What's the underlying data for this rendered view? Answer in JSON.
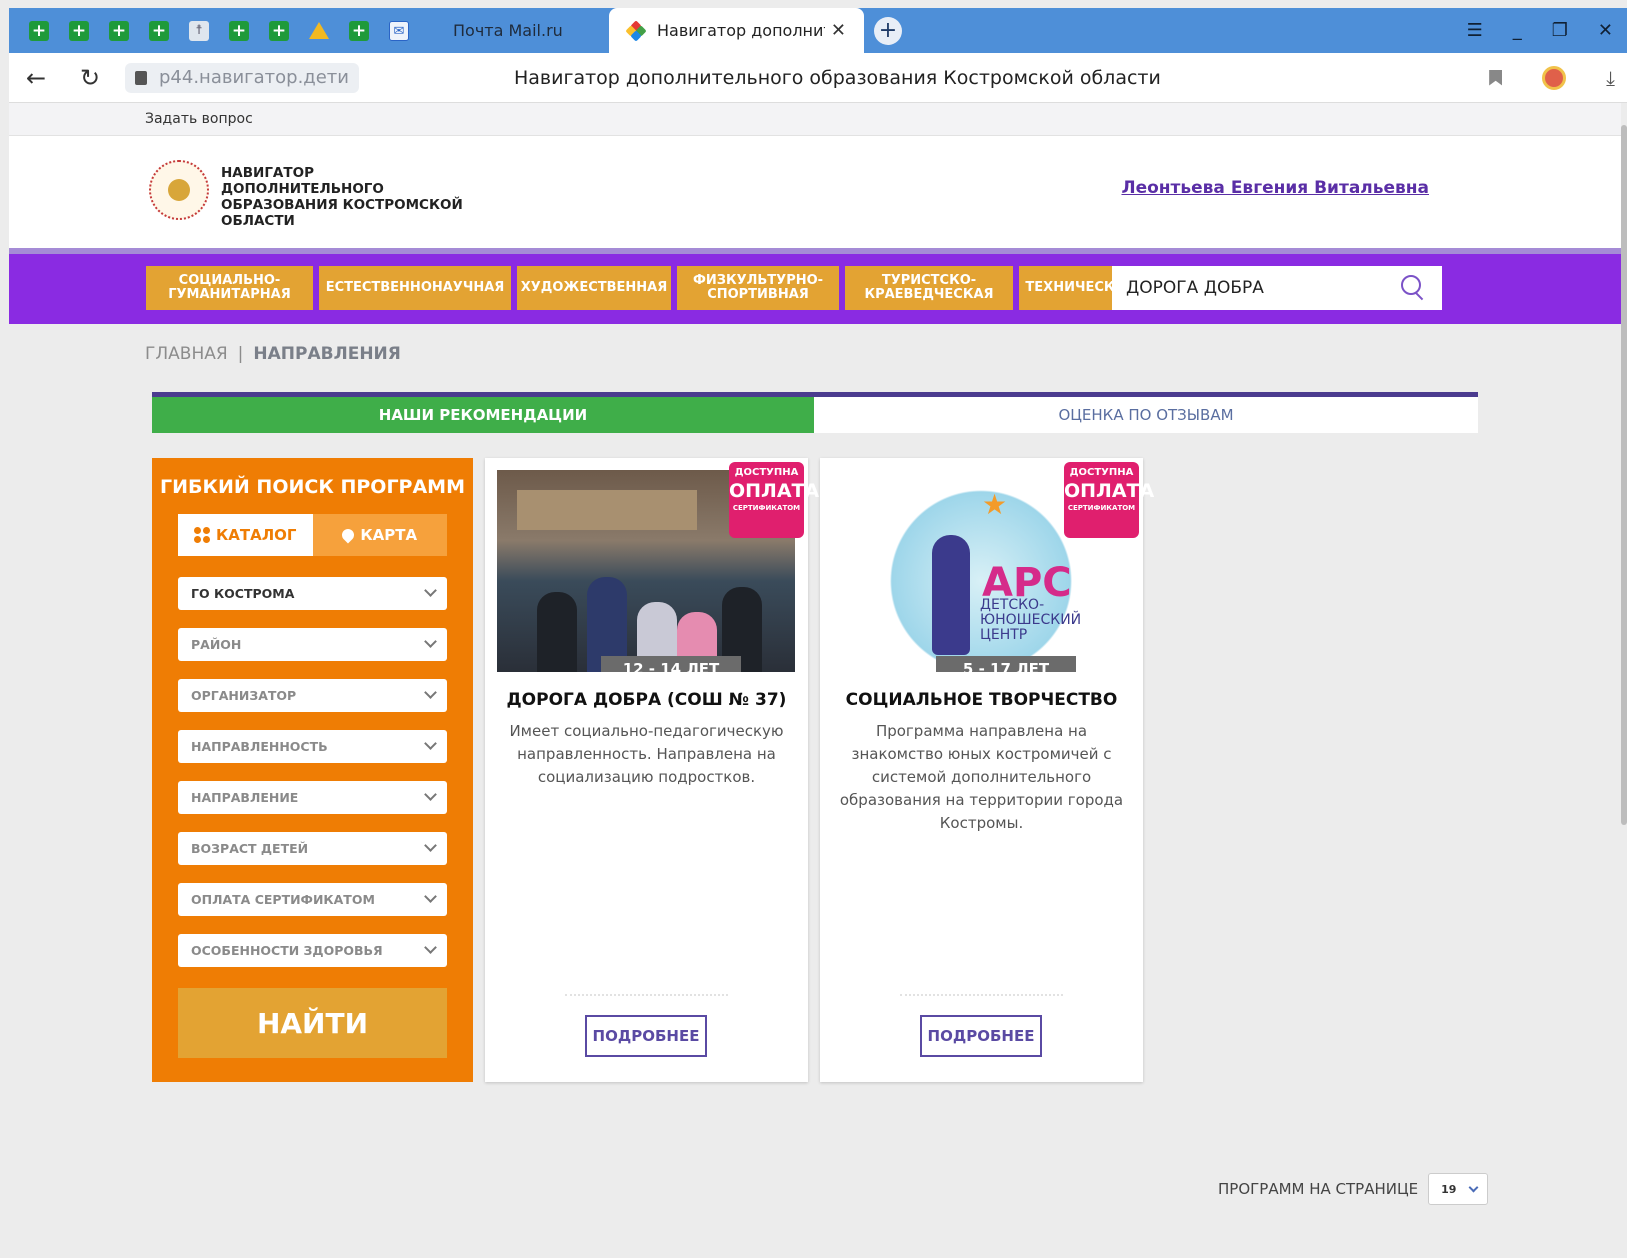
{
  "browser": {
    "tabs": [
      {
        "label": "Почта Mail.ru"
      },
      {
        "label": "Навигатор дополнител"
      }
    ],
    "url": "p44.навигатор.дети",
    "page_title": "Навигатор дополнительного образования Костромской области"
  },
  "site": {
    "ask_link": "Задать вопрос",
    "brand": "НАВИГАТОР ДОПОЛНИТЕЛЬНОГО ОБРАЗОВАНИЯ КОСТРОМСКОЙ ОБЛАСТИ",
    "user_name": "Леонтьева Евгения Витальевна",
    "categories": [
      "СОЦИАЛЬНО-ГУМАНИТАРНАЯ",
      "ЕСТЕСТВЕННОНАУЧНАЯ",
      "ХУДОЖЕСТВЕННАЯ",
      "ФИЗКУЛЬТУРНО-СПОРТИВНАЯ",
      "ТУРИСТСКО-КРАЕВЕДЧЕСКАЯ",
      "ТЕХНИЧЕСКАЯ"
    ],
    "search_value": "ДОРОГА ДОБРА",
    "breadcrumb": {
      "home": "ГЛАВНАЯ",
      "separator": "|",
      "current": "НАПРАВЛЕНИЯ"
    },
    "view_tabs": {
      "recommend": "НАШИ РЕКОМЕНДАЦИИ",
      "reviews": "ОЦЕНКА ПО ОТЗЫВАМ"
    },
    "filter": {
      "title": "ГИБКИЙ ПОИСК ПРОГРАММ",
      "catalog": "КАТАЛОГ",
      "map": "КАРТА",
      "selects": [
        "ГО КОСТРОМА",
        "РАЙОН",
        "ОРГАНИЗАТОР",
        "НАПРАВЛЕННОСТЬ",
        "НАПРАВЛЕНИЕ",
        "ВОЗРАСТ ДЕТЕЙ",
        "ОПЛАТА СЕРТИФИКАТОМ",
        "ОСОБЕННОСТИ ЗДОРОВЬЯ"
      ],
      "find": "НАЙТИ"
    },
    "badge": {
      "line1": "ДОСТУПНА",
      "line2": "ОПЛАТА",
      "line3": "СЕРТИФИКАТОМ"
    },
    "cards": [
      {
        "age": "12 - 14 ЛЕТ",
        "title": "ДОРОГА ДОБРА (СОШ № 37)",
        "desc": "Имеет социально-педагогическую направленность. Направлена на социализацию подростков.",
        "more": "ПОДРОБНЕЕ"
      },
      {
        "age": "5 - 17 ЛЕТ",
        "title": "СОЦИАЛЬНОЕ ТВОРЧЕСТВО",
        "desc": "Программа направлена на знакомство юных костромичей с системой дополнительного образования на территории города Костромы.",
        "more": "ПОДРОБНЕЕ",
        "logo_text": "АРС",
        "logo_sub": "ДЕТСКО-ЮНОШЕСКИЙ ЦЕНТР"
      }
    ],
    "per_page_label": "ПРОГРАММ НА СТРАНИЦЕ",
    "per_page_value": "19"
  }
}
